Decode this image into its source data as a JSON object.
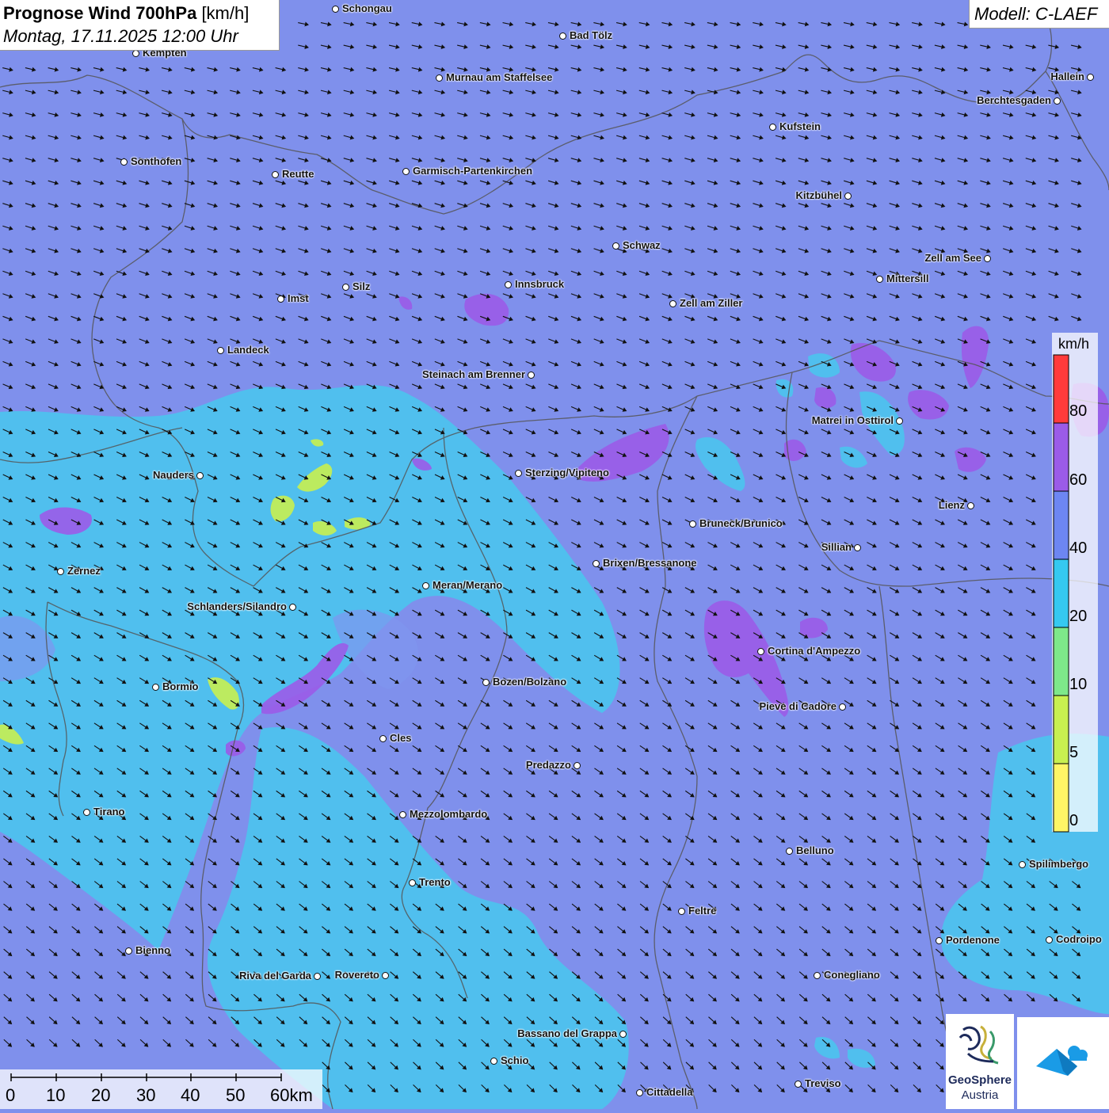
{
  "header": {
    "title_bold": "Prognose Wind 700hPa",
    "title_unit": "[km/h]",
    "datetime": "Montag, 17.11.2025 12:00 Uhr",
    "model": "Modell: C-LAEF"
  },
  "legend": {
    "unit": "km/h",
    "labels": [
      "80",
      "60",
      "40",
      "20",
      "10",
      "5",
      "0"
    ],
    "colors": [
      "#ff3b3b",
      "#9b5be8",
      "#6d86f2",
      "#35c9f0",
      "#7ee88a",
      "#c8f050",
      "#fff566"
    ]
  },
  "scalebar": {
    "labels": [
      "0",
      "10",
      "20",
      "30",
      "40",
      "50",
      "60km"
    ]
  },
  "logos": {
    "geosphere_line1": "GeoSphere",
    "geosphere_line2": "Austria"
  },
  "wind": {
    "direction": "north-westerly flow (arrows point south-east)"
  },
  "cities": [
    {
      "name": "Schongau"
    },
    {
      "name": "Bad Tölz"
    },
    {
      "name": "Kempten"
    },
    {
      "name": "Murnau am Staffelsee"
    },
    {
      "name": "Hallein"
    },
    {
      "name": "Berchtesgaden"
    },
    {
      "name": "Kufstein"
    },
    {
      "name": "Sonthofen"
    },
    {
      "name": "Reutte"
    },
    {
      "name": "Garmisch-Partenkirchen"
    },
    {
      "name": "Kitzbühel"
    },
    {
      "name": "Schwaz"
    },
    {
      "name": "Zell am See"
    },
    {
      "name": "Mittersill"
    },
    {
      "name": "Silz"
    },
    {
      "name": "Innsbruck"
    },
    {
      "name": "Imst"
    },
    {
      "name": "Zell am Ziller"
    },
    {
      "name": "Landeck"
    },
    {
      "name": "Steinach am Brenner"
    },
    {
      "name": "Matrei in Osttirol"
    },
    {
      "name": "Nauders"
    },
    {
      "name": "Sterzing/Vipiteno"
    },
    {
      "name": "Lienz"
    },
    {
      "name": "Bruneck/Brunico"
    },
    {
      "name": "Sillian"
    },
    {
      "name": "Zernez"
    },
    {
      "name": "Brixen/Bressanone"
    },
    {
      "name": "Meran/Merano"
    },
    {
      "name": "Schlanders/Silandro"
    },
    {
      "name": "Cortina d'Ampezzo"
    },
    {
      "name": "Bormio"
    },
    {
      "name": "Bozen/Bolzano"
    },
    {
      "name": "Pieve di Cadore"
    },
    {
      "name": "Cles"
    },
    {
      "name": "Predazzo"
    },
    {
      "name": "Tirano"
    },
    {
      "name": "Mezzolombardo"
    },
    {
      "name": "Belluno"
    },
    {
      "name": "Spilimbergo"
    },
    {
      "name": "Trento"
    },
    {
      "name": "Feltre"
    },
    {
      "name": "Pordenone"
    },
    {
      "name": "Codroipo"
    },
    {
      "name": "Bienno"
    },
    {
      "name": "Riva del Garda"
    },
    {
      "name": "Rovereto"
    },
    {
      "name": "Conegliano"
    },
    {
      "name": "Bassano del Grappa"
    },
    {
      "name": "Schio"
    },
    {
      "name": "Treviso"
    },
    {
      "name": "Cittadella"
    }
  ]
}
